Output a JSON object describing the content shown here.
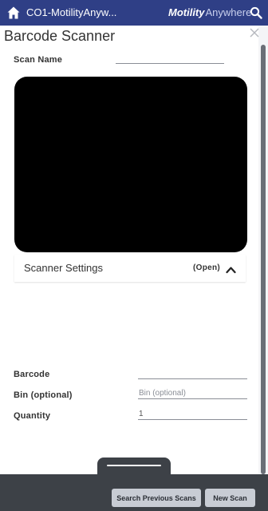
{
  "header": {
    "app_title": "CO1-MotilityAnyw...",
    "brand_strong": "Motility",
    "brand_light": "Anywhere"
  },
  "dialog": {
    "title": "Barcode Scanner"
  },
  "scan_name": {
    "label": "Scan Name",
    "value": "",
    "placeholder": ""
  },
  "scanner_settings": {
    "label": "Scanner Settings",
    "state": "(Open)"
  },
  "fields": {
    "barcode": {
      "label": "Barcode",
      "value": "",
      "placeholder": ""
    },
    "bin": {
      "label": "Bin (optional)",
      "value": "",
      "placeholder": "Bin (optional)"
    },
    "quantity": {
      "label": "Quantity",
      "value": "1",
      "placeholder": ""
    }
  },
  "footer": {
    "search_previous_label": "Search Previous Scans",
    "new_scan_label": "New Scan"
  },
  "colors": {
    "header_bg": "#2f3f86",
    "footer_bg": "#3d4147",
    "button_bg": "#c8ccd4"
  },
  "icons": [
    "home-icon",
    "search-icon",
    "close-icon",
    "chevron-up-icon"
  ]
}
